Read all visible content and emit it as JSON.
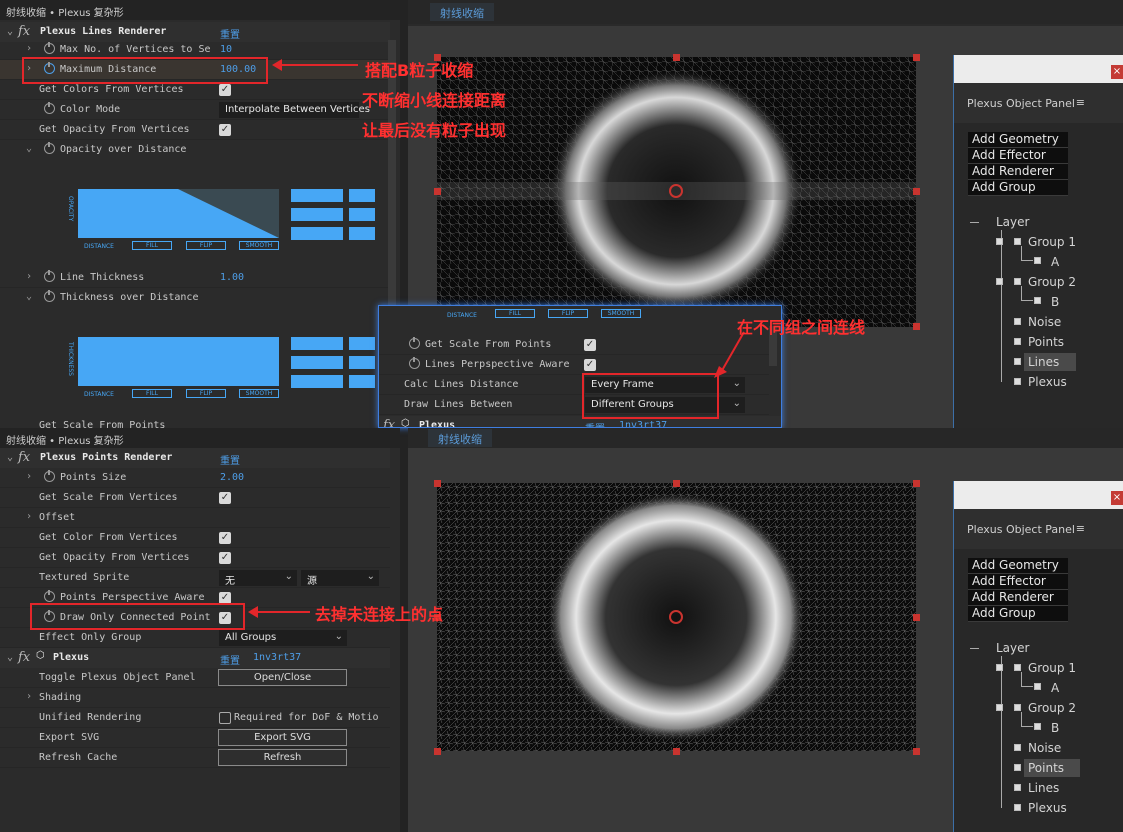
{
  "top_panel": {
    "title": "射线收缩 • Plexus 复杂形",
    "effect_name": "Plexus Lines Renderer",
    "reset": "重置",
    "rows": {
      "max_vertices": {
        "label": "Max No. of Vertices to Se",
        "value": "10"
      },
      "max_distance": {
        "label": "Maximum Distance",
        "value": "100.00"
      },
      "colors_from_vertices": {
        "label": "Get Colors From Vertices"
      },
      "color_mode": {
        "label": "Color Mode",
        "value": "Interpolate Between Vertices"
      },
      "opacity_from_vertices": {
        "label": "Get Opacity From Vertices"
      },
      "opacity_over_distance": {
        "label": "Opacity over Distance"
      },
      "line_thickness": {
        "label": "Line Thickness",
        "value": "1.00"
      },
      "thickness_over_distance": {
        "label": "Thickness over Distance"
      },
      "get_scale_cut": {
        "label": "Get Scale From Points"
      }
    },
    "graph1": {
      "axis": "OPACITY",
      "distance": "DISTANCE",
      "fill": "FILL",
      "flip": "FLIP",
      "smooth": "SMOOTH"
    },
    "graph2": {
      "axis": "THICKNESS",
      "distance": "DISTANCE",
      "fill": "FILL",
      "flip": "FLIP",
      "smooth": "SMOOTH"
    }
  },
  "popup_panel": {
    "graph": {
      "distance": "DISTANCE",
      "fill": "FILL",
      "flip": "FLIP",
      "smooth": "SMOOTH"
    },
    "get_scale": {
      "label": "Get Scale From Points"
    },
    "perspective": {
      "label": "Lines Perpspective Aware"
    },
    "calc_distance": {
      "label": "Calc Lines Distance",
      "value": "Every Frame"
    },
    "draw_between": {
      "label": "Draw Lines Between",
      "value": "Different Groups"
    },
    "fx_name": "Plexus",
    "reset": "重置",
    "code": "1nv3rt37"
  },
  "bottom_panel": {
    "title": "射线收缩 • Plexus 复杂形",
    "effect_name": "Plexus Points Renderer",
    "reset": "重置",
    "rows": {
      "points_size": {
        "label": "Points Size",
        "value": "2.00"
      },
      "scale_from_vertices": {
        "label": "Get Scale From Vertices"
      },
      "offset": {
        "label": "Offset"
      },
      "color_from_vertices": {
        "label": "Get Color From Vertices"
      },
      "opacity_from_vertices": {
        "label": "Get Opacity From Vertices"
      },
      "textured_sprite": {
        "label": "Textured Sprite",
        "value1": "无",
        "value2": "源"
      },
      "perspective": {
        "label": "Points Perspective Aware"
      },
      "draw_connected": {
        "label": "Draw Only Connected Point"
      },
      "effect_only_group": {
        "label": "Effect Only Group",
        "value": "All Groups"
      }
    },
    "plexus": {
      "name": "Plexus",
      "reset": "重置",
      "code": "1nv3rt37",
      "toggle": {
        "label": "Toggle Plexus Object Panel",
        "button": "Open/Close"
      },
      "shading": {
        "label": "Shading"
      },
      "unified": {
        "label": "Unified Rendering",
        "checkbox_label": "Required for DoF & Motio"
      },
      "export": {
        "label": "Export SVG",
        "button": "Export SVG"
      },
      "refresh": {
        "label": "Refresh Cache",
        "button": "Refresh"
      }
    }
  },
  "viewer_top": {
    "tab": "射线收缩"
  },
  "viewer_bottom": {
    "tab": "射线收缩"
  },
  "object_panel": {
    "title": "Plexus Object Panel",
    "menu_icon": "≡",
    "close": "×",
    "buttons": [
      "Add Geometry",
      "Add Effector",
      "Add Renderer",
      "Add Group"
    ],
    "tree": {
      "layer": "Layer",
      "group1": "Group 1",
      "a": "A",
      "group2": "Group 2",
      "b": "B",
      "noise": "Noise",
      "points": "Points",
      "lines": "Lines",
      "plexus": "Plexus"
    },
    "selected_top": "Lines",
    "selected_bottom": "Points"
  },
  "annotations": {
    "note1_line1": "搭配B粒子收缩",
    "note1_line2": "不断缩小线连接距离",
    "note1_line3": "让最后没有粒子出现",
    "note2": "在不同组之间连线",
    "note3": "去掉未连接上的点"
  },
  "colors": {
    "accent_blue": "#47a7f5",
    "annotation_red": "#e3262a",
    "value_blue": "#4e9ee8"
  }
}
